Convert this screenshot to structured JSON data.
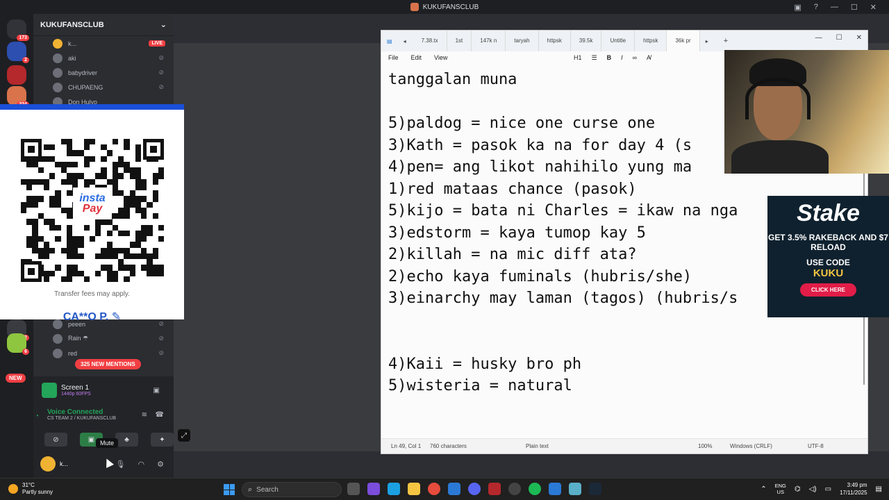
{
  "window": {
    "title": "KUKUFANSCLUB"
  },
  "rail": {
    "badges": [
      "173",
      "2",
      "324",
      "92",
      "6"
    ],
    "new_label": "NEW"
  },
  "guild": {
    "name": "KUKUFANSCLUB"
  },
  "voice_users_top": [
    {
      "name": "k...",
      "live": "LIVE"
    },
    {
      "name": "aki"
    },
    {
      "name": "babydriver"
    },
    {
      "name": "CHUPAENG"
    },
    {
      "name": "Don Hulyo"
    }
  ],
  "voice_users_bottom": [
    {
      "name": "peeen"
    },
    {
      "name": "Rain ☂"
    },
    {
      "name": "red"
    }
  ],
  "mentions": "325 NEW MENTIONS",
  "screen_panel": {
    "title": "Screen 1",
    "sub": "1440p 60FPS"
  },
  "voice": {
    "status": "Voice Connected",
    "channel": "CS TEAM 2 / KUKUFANSCLUB"
  },
  "mute_tooltip": "Mute",
  "user_panel": {
    "name": "k..."
  },
  "qr": {
    "logo_top": "insta",
    "logo_bottom": "Pay",
    "fee_note": "Transfer fees may apply.",
    "account_name": "CA**O P."
  },
  "notepad": {
    "tabs": [
      "7.38.tx",
      "1st",
      "147k n",
      "taryah",
      "httpsk",
      "39.5k",
      "Untitle",
      "httpsk",
      "36k pr"
    ],
    "menu": [
      "File",
      "Edit",
      "View"
    ],
    "heading_tool": "H1",
    "lines": [
      "tanggalan muna",
      "",
      "5)paldog = nice one curse one",
      "3)Kath = pasok ka na for day 4 (s",
      "4)pen= ang likot nahihilo yung ma",
      "1)red mataas chance (pasok)",
      "5)kijo = bata ni Charles = ikaw na nga",
      "3)edstorm = kaya tumop kay 5",
      "2)killah = na mic diff ata?",
      "2)echo kaya fuminals (hubris/she)",
      "3)einarchy may laman (tagos) (hubris/s",
      "",
      "",
      "4)Kaii = husky bro ph",
      "5)wisteria = natural"
    ],
    "status": {
      "position": "Ln 49, Col 1",
      "chars": "760 characters",
      "format": "Plain text",
      "zoom": "100%",
      "eol": "Windows (CRLF)",
      "encoding": "UTF-8"
    }
  },
  "stake_ad": {
    "brand": "Stake",
    "offer": "GET 3.5% RAKEBACK AND $7 RELOAD",
    "use_code": "USE CODE",
    "code": "KUKU",
    "cta": "CLICK HERE"
  },
  "taskbar": {
    "weather_temp": "31°C",
    "weather_desc": "Partly sunny",
    "search_placeholder": "Search",
    "lang_line1": "ENG",
    "lang_line2": "US",
    "time": "3:49 pm",
    "date": "17/11/2025"
  }
}
